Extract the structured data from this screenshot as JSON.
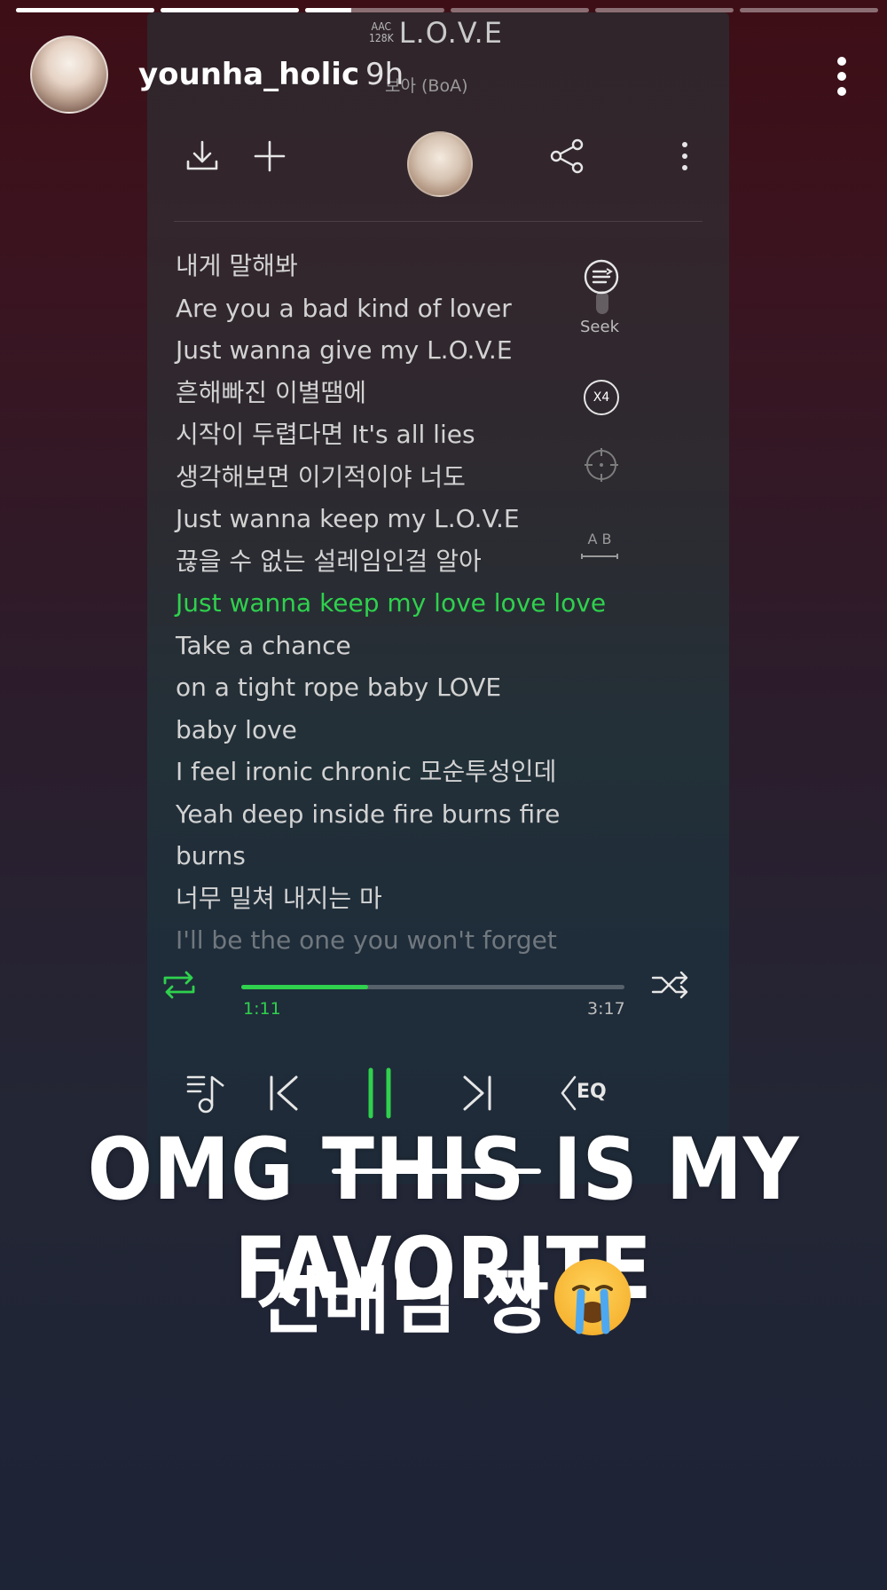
{
  "story": {
    "segments": [
      1,
      1,
      0.33,
      0,
      0,
      0
    ],
    "username": "younha_holic",
    "time": "9h"
  },
  "player": {
    "codec_line1": "AAC",
    "codec_line2": "128K",
    "song_title": "L.O.V.E",
    "artist": "보아 (BoA)",
    "side_seek_label": "Seek",
    "side_speed_label": "X4",
    "side_ab_label": "A B",
    "lyrics": [
      "내게 말해봐",
      "Are you a bad kind of lover",
      "Just wanna give my L.O.V.E",
      "흔해빠진 이별땜에",
      "시작이 두렵다면 It's all lies",
      "생각해보면 이기적이야 너도",
      "Just wanna keep my L.O.V.E",
      "끊을 수 없는 설레임인걸 알아",
      "Just wanna keep my love love love",
      "Take a chance",
      "on a tight rope baby LOVE",
      "baby love",
      "I feel ironic chronic 모순투성인데",
      "Yeah deep inside fire burns fire",
      "burns",
      "너무 밀쳐 내지는 마",
      "I'll be the one you won't forget"
    ],
    "active_lyric_index": 8,
    "current_time": "1:11",
    "total_time": "3:17",
    "progress": 0.33,
    "eq_label": "EQ",
    "accent_color": "#2fd14d"
  },
  "caption": {
    "line1": "OMG THIS IS MY FAVORITE",
    "line2": "선배님 짱",
    "emoji": "loudly-crying-face"
  }
}
